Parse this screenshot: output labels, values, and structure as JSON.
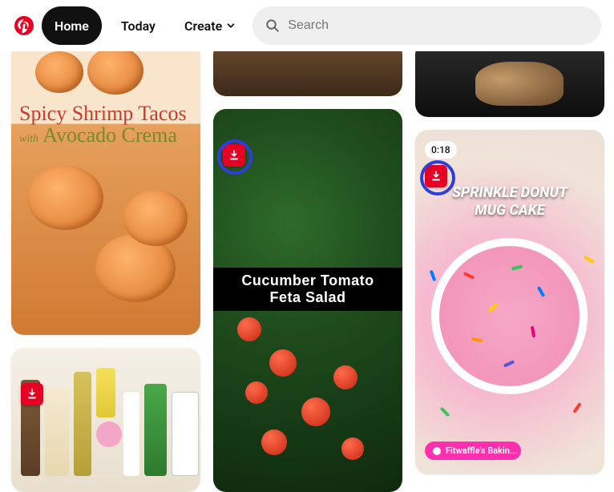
{
  "header": {
    "nav": {
      "home": "Home",
      "today": "Today",
      "create": "Create"
    },
    "search": {
      "placeholder": "Search"
    }
  },
  "colors": {
    "brand_red": "#e60023",
    "annotation_blue": "#2d3fd9",
    "user_pill": "#ff2fb0"
  },
  "pins": {
    "tacos": {
      "title_line1": "Spicy Shrimp Tacos",
      "title_with": "with",
      "title_line2": "Avocado Crema"
    },
    "salad": {
      "title_line1": "Cucumber Tomato",
      "title_line2": "Feta Salad"
    },
    "donut": {
      "duration": "0:18",
      "title_line1": "SPRINKLE DONUT",
      "title_line2": "MUG CAKE",
      "user_label": "Fitwaffle's Bakin..."
    }
  }
}
